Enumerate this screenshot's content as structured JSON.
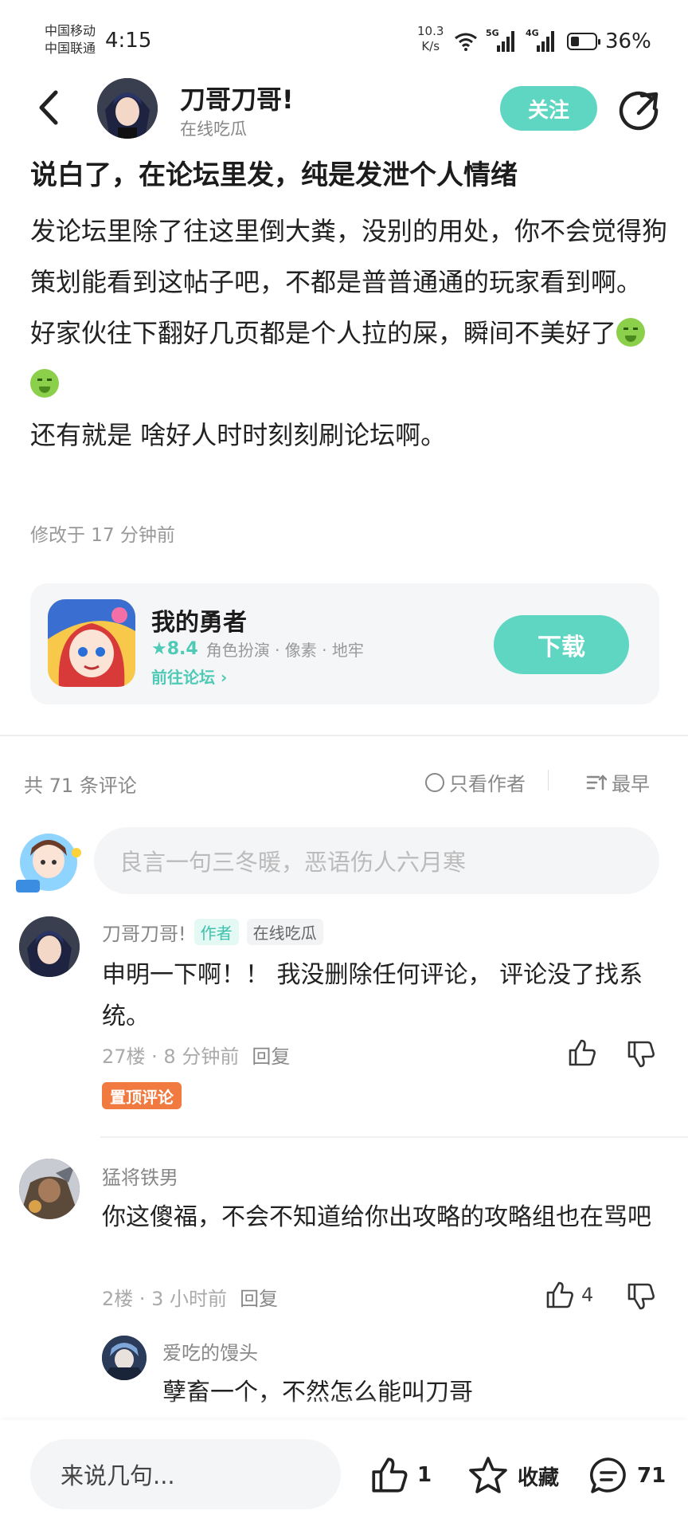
{
  "status_bar": {
    "carrier1": "中国移动",
    "carrier2": "中国联通",
    "time": "4:15",
    "speed_value": "10.3",
    "speed_unit": "K/s",
    "net1": "5G",
    "net2": "4G",
    "battery_percent": "36%",
    "battery_level": 0.36
  },
  "header": {
    "author_name": "刀哥刀哥!",
    "author_tag": "在线吃瓜",
    "follow_label": "关注"
  },
  "post": {
    "title": "说白了，在论坛里发，纯是发泄个人情绪",
    "paragraph1": "发论坛里除了往这里倒大粪，没别的用处，你不会觉得狗策划能看到这帖子吧，不都是普普通通的玩家看到啊。",
    "paragraph2": "好家伙往下翻好几页都是个人拉的屎，瞬间不美好了",
    "paragraph3": "还有就是 啥好人时时刻刻刷论坛啊。",
    "edited": "修改于 17 分钟前"
  },
  "game_card": {
    "name": "我的勇者",
    "rating": "8.4",
    "tags": "角色扮演 · 像素 · 地牢",
    "forum_link": "前往论坛",
    "download_label": "下载"
  },
  "comments_header": {
    "count": "共 71 条评论",
    "author_only": "只看作者",
    "sort": "最早"
  },
  "comment_input": {
    "placeholder": "良言一句三冬暖，恶语伤人六月寒"
  },
  "comments": [
    {
      "name": "刀哥刀哥!",
      "badge_author": "作者",
      "badge_tag": "在线吃瓜",
      "text": "申明一下啊！！  我没删除任何评论， 评论没了找系统。",
      "meta": "27楼 · 8 分钟前",
      "reply": "回复",
      "pinned": "置顶评论"
    },
    {
      "name": "猛将铁男",
      "text": "你这傻福，不会不知道给你出攻略的攻略组也在骂吧",
      "meta": "2楼 · 3 小时前",
      "reply": "回复",
      "likes": "4"
    }
  ],
  "sub_reply": {
    "name": "爱吃的馒头",
    "text": "孽畜一个，不然怎么能叫刀哥"
  },
  "bottom_bar": {
    "input_placeholder": "来说几句...",
    "like_count": "1",
    "favorite_label": "收藏",
    "comment_count": "71"
  },
  "colors": {
    "accent": "#5fd6c2",
    "pin_badge": "#f07a3f"
  },
  "icons": [
    "back-arrow-icon",
    "share-icon",
    "star-icon",
    "chevron-right-icon",
    "circle-icon",
    "sort-icon",
    "thumb-up-icon",
    "thumb-down-icon",
    "favorite-star-icon",
    "comment-icon",
    "wifi-icon",
    "signal-icon",
    "battery-icon"
  ]
}
